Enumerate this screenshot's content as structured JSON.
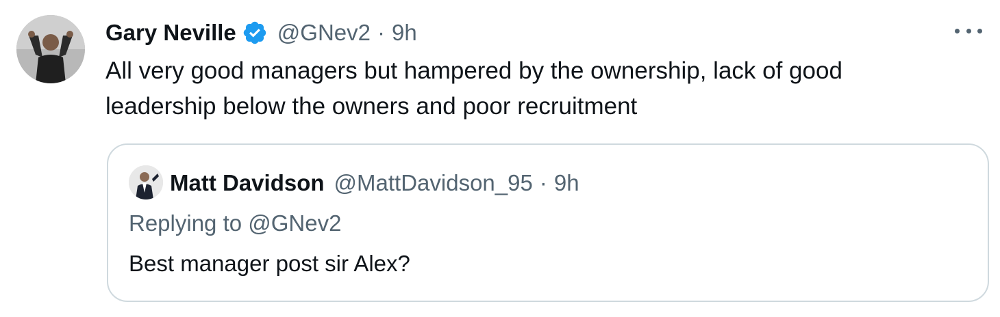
{
  "tweet": {
    "author_name": "Gary Neville",
    "handle": "@GNev2",
    "separator": "·",
    "time": "9h",
    "text": "All very good managers but hampered by the ownership, lack of good\nleadership below the owners and poor recruitment",
    "verified_color": "#1d9bf0",
    "avatar_icon": "user-avatar"
  },
  "quoted_tweet": {
    "author_name": "Matt Davidson",
    "handle": "@MattDavidson_95",
    "separator": "·",
    "time": "9h",
    "replying_to": "Replying to @GNev2",
    "text": "Best manager post sir Alex?"
  },
  "more_menu_icon": "more-horizontal-icon"
}
